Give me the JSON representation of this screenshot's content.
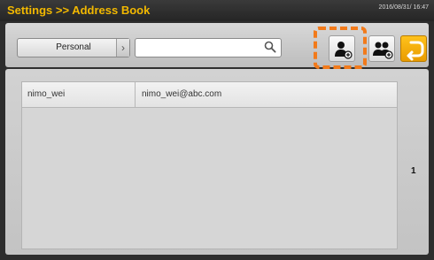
{
  "header": {
    "title": "Settings >> Address Book",
    "datetime": "2016/08/31/ 16:47"
  },
  "toolbar": {
    "group_select": {
      "value": "Personal"
    },
    "search": {
      "value": "",
      "placeholder": ""
    },
    "buttons": [
      {
        "icon": "add-contact-icon"
      },
      {
        "icon": "add-group-icon"
      },
      {
        "icon": "back-icon"
      }
    ]
  },
  "contacts": [
    {
      "name": "nimo_wei",
      "email": "nimo_wei@abc.com"
    }
  ],
  "pagination": {
    "page": "1"
  },
  "colors": {
    "title": "#f2b800",
    "highlight": "#f27a1a",
    "back_button": "#f2a900"
  }
}
